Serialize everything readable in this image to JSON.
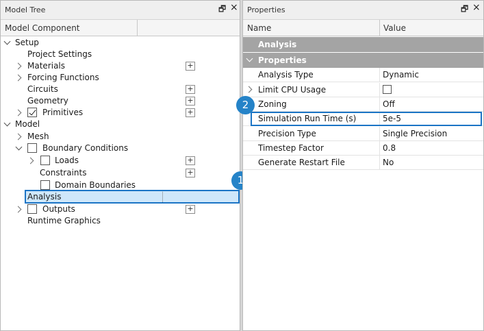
{
  "model_tree": {
    "title": "Model Tree",
    "column": "Model Component",
    "items": [
      {
        "label": "Setup"
      },
      {
        "label": "Project Settings"
      },
      {
        "label": "Materials",
        "plus": "+"
      },
      {
        "label": "Forcing Functions"
      },
      {
        "label": "Circuits",
        "plus": "+"
      },
      {
        "label": "Geometry",
        "plus": "+"
      },
      {
        "label": "Primitives",
        "plus": "+"
      },
      {
        "label": "Model"
      },
      {
        "label": "Mesh"
      },
      {
        "label": "Boundary Conditions"
      },
      {
        "label": "Loads",
        "plus": "+"
      },
      {
        "label": "Constraints",
        "plus": "+"
      },
      {
        "label": "Domain Boundaries"
      },
      {
        "label": "Analysis"
      },
      {
        "label": "Outputs",
        "plus": "+"
      },
      {
        "label": "Runtime Graphics"
      }
    ]
  },
  "properties": {
    "title": "Properties",
    "col_name": "Name",
    "col_value": "Value",
    "group_analysis": "Analysis",
    "group_properties": "Properties",
    "rows": [
      {
        "name": "Analysis Type",
        "value": "Dynamic"
      },
      {
        "name": "Limit CPU Usage",
        "value": ""
      },
      {
        "name": "Zoning",
        "value": "Off"
      },
      {
        "name": "Simulation Run Time (s)",
        "value": "5e-5"
      },
      {
        "name": "Precision Type",
        "value": "Single Precision"
      },
      {
        "name": "Timestep Factor",
        "value": "0.8"
      },
      {
        "name": "Generate Restart File",
        "value": "No"
      }
    ]
  },
  "callouts": {
    "one": "1",
    "two": "2"
  },
  "toolbar": {
    "restore": "🗗",
    "close": "×"
  }
}
